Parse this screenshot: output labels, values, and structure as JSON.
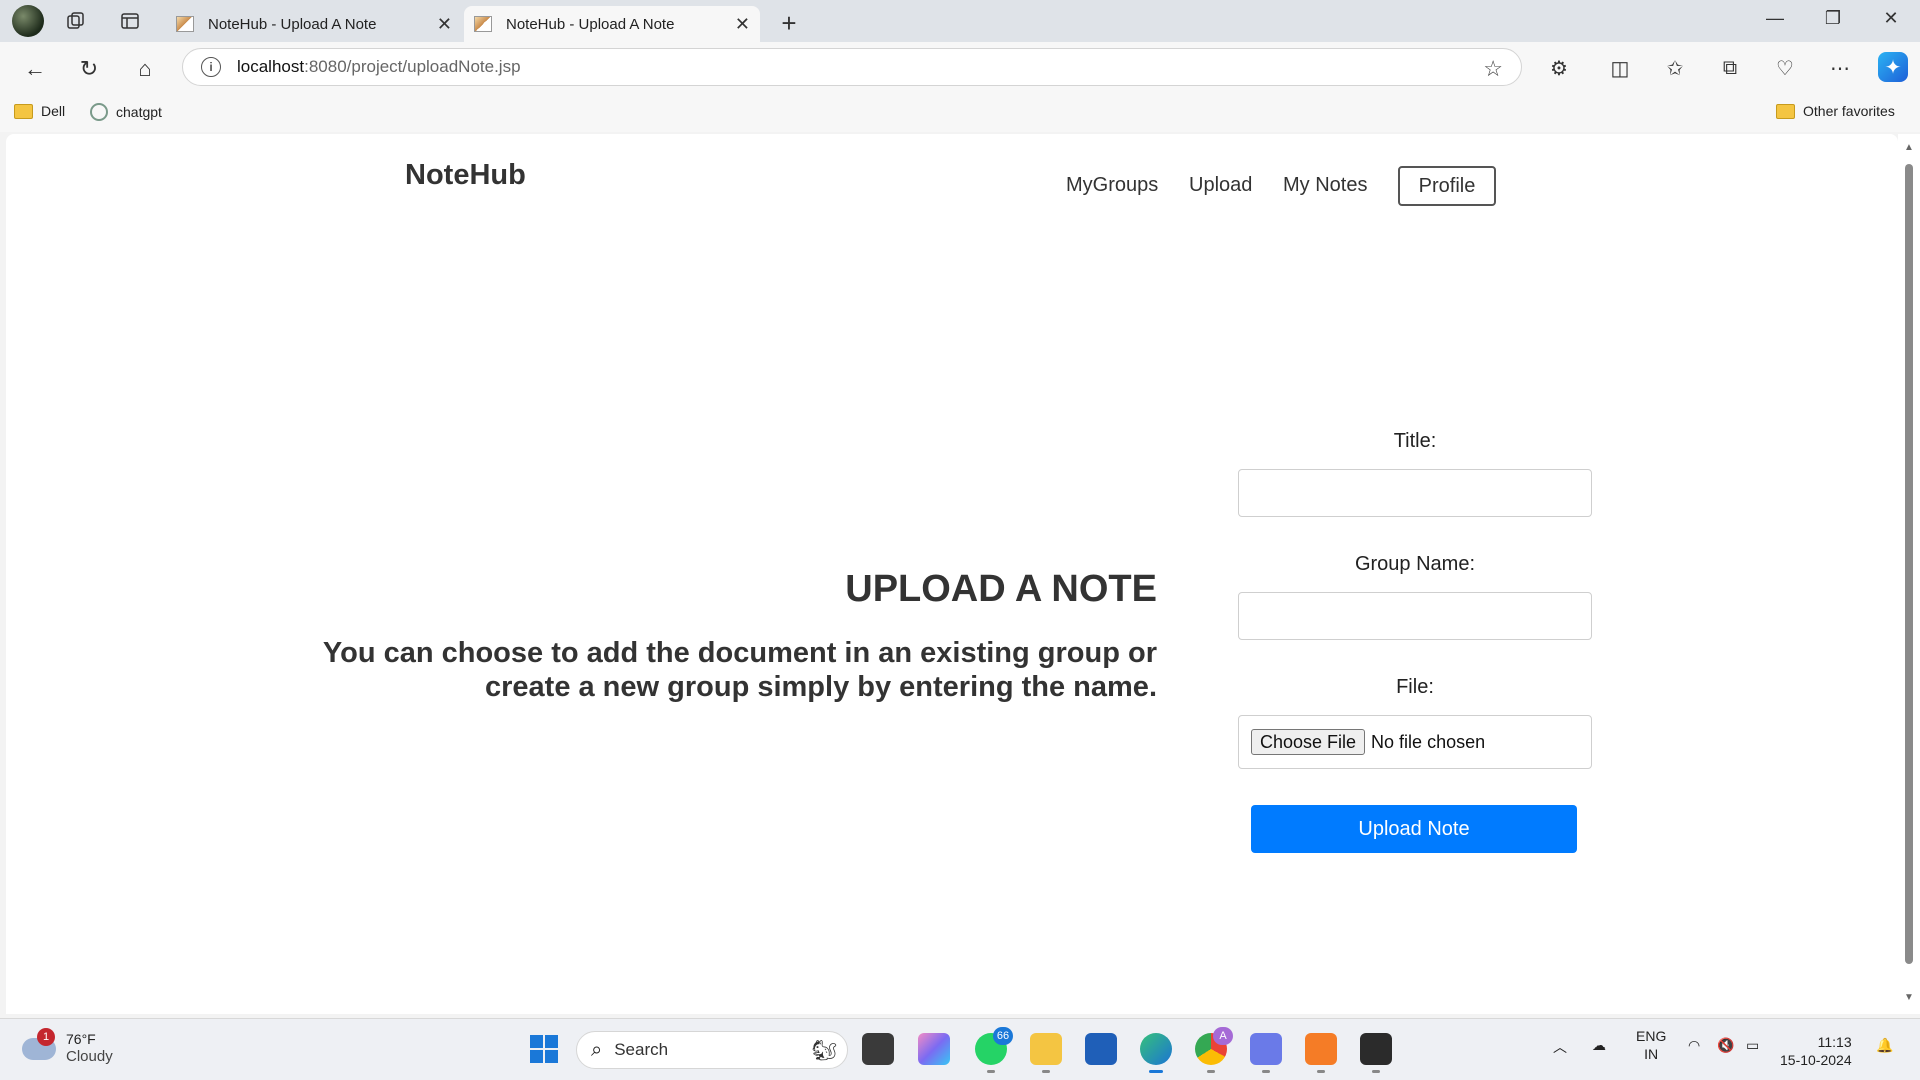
{
  "browser": {
    "tabs": [
      {
        "title": "NoteHub - Upload A Note",
        "active": false
      },
      {
        "title": "NoteHub - Upload A Note",
        "active": true
      }
    ],
    "address": {
      "host": "localhost",
      "path": ":8080/project/uploadNote.jsp"
    },
    "favorites": [
      {
        "label": "Dell",
        "icon": "folder-icon"
      },
      {
        "label": "chatgpt",
        "icon": "chatgpt-icon"
      }
    ],
    "other_favorites": "Other favorites"
  },
  "page": {
    "logo": "NoteHub",
    "nav": {
      "mygroups": "MyGroups",
      "upload": "Upload",
      "mynotes": "My Notes",
      "profile": "Profile"
    },
    "hero": {
      "title": "UPLOAD A NOTE",
      "text": "You can choose to add the document in an existing group or create a new group simply by entering the name."
    },
    "form": {
      "title_label": "Title:",
      "title_value": "",
      "group_label": "Group Name:",
      "group_value": "",
      "file_label": "File:",
      "choose_file": "Choose File",
      "no_file": "No file chosen",
      "submit": "Upload Note"
    },
    "accent_color": "#007bff"
  },
  "taskbar": {
    "weather": {
      "temp": "76°F",
      "condition": "Cloudy",
      "badge": "1"
    },
    "search_placeholder": "Search",
    "whatsapp_badge": "66",
    "chrome_badge": "A",
    "lang": {
      "line1": "ENG",
      "line2": "IN"
    },
    "time": "11:13",
    "date": "15-10-2024"
  }
}
